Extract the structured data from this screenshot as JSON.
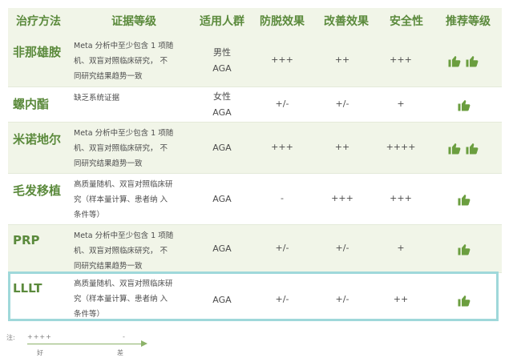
{
  "headers": [
    "治疗方法",
    "证据等级",
    "适用人群",
    "防脱效果",
    "改善效果",
    "安全性",
    "推荐等级"
  ],
  "rows": [
    {
      "method": "非那雄胺",
      "evidence": [
        "Meta 分析中至少包含 1 项随",
        "机、双盲对照临床研究， 不",
        "同研究结果趋势一致"
      ],
      "population": [
        "男性",
        "AGA"
      ],
      "hair_loss": "+++",
      "improvement": "++",
      "safety": "+++",
      "thumbs": 2
    },
    {
      "method": "螺内酯",
      "evidence": [
        "缺乏系统证据"
      ],
      "population": [
        "女性",
        "AGA"
      ],
      "hair_loss": "+/-",
      "improvement": "+/-",
      "safety": "+",
      "thumbs": 1
    },
    {
      "method": "米诺地尔",
      "evidence": [
        "Meta 分析中至少包含 1 项随",
        "机、双盲对照临床研究， 不",
        "同研究结果趋势一致"
      ],
      "population": [
        "AGA"
      ],
      "hair_loss": "+++",
      "improvement": "++",
      "safety": "++++",
      "thumbs": 2
    },
    {
      "method": "毛发移植",
      "evidence": [
        "高质量随机、双盲对照临床研",
        "究（样本量计算、患者纳 入",
        "条件等）"
      ],
      "population": [
        "AGA"
      ],
      "hair_loss": "-",
      "improvement": "+++",
      "safety": "+++",
      "thumbs": 1
    },
    {
      "method": "PRP",
      "evidence": [
        "Meta 分析中至少包含 1 项随",
        "机、双盲对照临床研究， 不",
        "同研究结果趋势一致"
      ],
      "population": [
        "AGA"
      ],
      "hair_loss": "+/-",
      "improvement": "+/-",
      "safety": "+",
      "thumbs": 1
    },
    {
      "method": "LLLT",
      "evidence": [
        "高质量随机、双盲对照临床研",
        "究（样本量计算、患者纳 入",
        "条件等）"
      ],
      "population": [
        "AGA"
      ],
      "hair_loss": "+/-",
      "improvement": "+/-",
      "safety": "++",
      "thumbs": 1
    }
  ],
  "legend": {
    "note": "注:",
    "left_symbol": "++++",
    "right_symbol": "-",
    "left_label": "好",
    "right_label": "差"
  },
  "colors": {
    "accent": "#5b8a3c",
    "shade": "#f1f5e8",
    "highlight": "#9fd8da",
    "thumb": "#6b9e3f"
  },
  "icons": {
    "recommend": "thumbs-up-icon"
  }
}
